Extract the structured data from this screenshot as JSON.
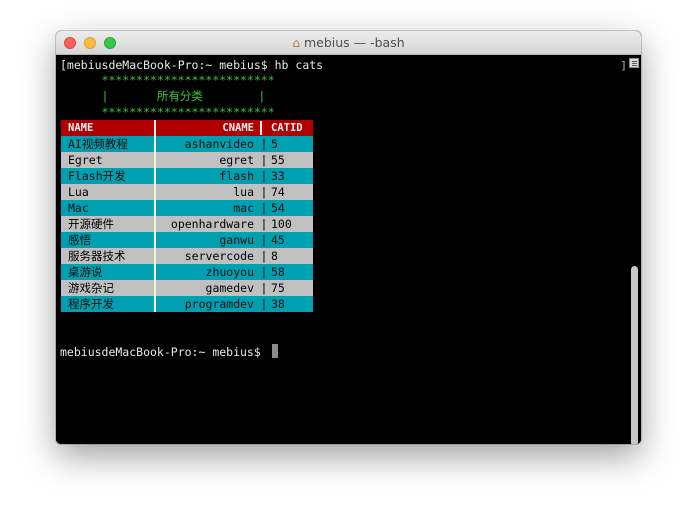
{
  "window": {
    "title": "mebius — -bash",
    "icon": "home-icon"
  },
  "terminal": {
    "command_line": "[mebiusdeMacBook-Pro:~ mebius$ hb cats",
    "banner_top": "      *************************",
    "banner_mid": "      |       所有分类        |",
    "banner_bottom": "      *************************",
    "prompt": "mebiusdeMacBook-Pro:~ mebius$ ",
    "right_bracket": "]"
  },
  "table": {
    "headers": {
      "name": "NAME",
      "cname": "CNAME",
      "catid": "CATID"
    },
    "separator": "|",
    "rows": [
      {
        "name": "AI视频教程",
        "cname": "ashanvideo",
        "catid": "5"
      },
      {
        "name": "Egret",
        "cname": "egret",
        "catid": "55"
      },
      {
        "name": "Flash开发",
        "cname": "flash",
        "catid": "33"
      },
      {
        "name": "Lua",
        "cname": "lua",
        "catid": "74"
      },
      {
        "name": "Mac",
        "cname": "mac",
        "catid": "54"
      },
      {
        "name": "开源硬件",
        "cname": "openhardware",
        "catid": "100"
      },
      {
        "name": "感悟",
        "cname": "ganwu",
        "catid": "45"
      },
      {
        "name": "服务器技术",
        "cname": "servercode",
        "catid": "8"
      },
      {
        "name": "桌游说",
        "cname": "zhuoyou",
        "catid": "58"
      },
      {
        "name": "游戏杂记",
        "cname": "gamedev",
        "catid": "75"
      },
      {
        "name": "程序开发",
        "cname": "programdev",
        "catid": "38"
      }
    ]
  },
  "colors": {
    "header_bg": "#b00000",
    "odd_row_bg": "#00a0b0",
    "even_row_bg": "#c0c0c0",
    "banner_green": "#35c735"
  }
}
